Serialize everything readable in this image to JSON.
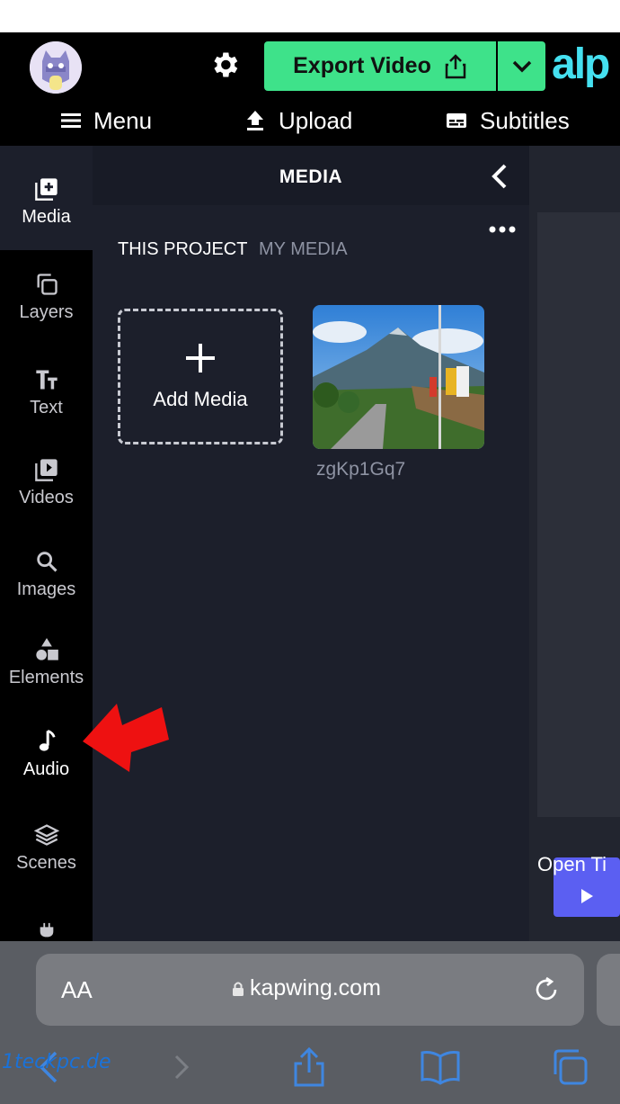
{
  "header": {
    "export_label": "Export Video",
    "brand": "alp",
    "nav": {
      "menu": "Menu",
      "upload": "Upload",
      "subtitles": "Subtitles"
    }
  },
  "sidebar": {
    "items": [
      {
        "label": "Media",
        "icon": "media-plus-icon"
      },
      {
        "label": "Layers",
        "icon": "layers-icon"
      },
      {
        "label": "Text",
        "icon": "text-icon"
      },
      {
        "label": "Videos",
        "icon": "videos-icon"
      },
      {
        "label": "Images",
        "icon": "search-icon"
      },
      {
        "label": "Elements",
        "icon": "shapes-icon"
      },
      {
        "label": "Audio",
        "icon": "music-note-icon"
      },
      {
        "label": "Scenes",
        "icon": "scenes-icon"
      }
    ]
  },
  "panel": {
    "title": "MEDIA",
    "tabs": [
      "THIS PROJECT",
      "MY MEDIA"
    ],
    "add_media_label": "Add Media",
    "media_items": [
      {
        "name": "zgKp1Gq7"
      }
    ]
  },
  "canvas": {
    "open_timeline": "Open Ti"
  },
  "browser": {
    "aa_label": "AA",
    "url": "kapwing.com"
  },
  "watermark": "1teckpc.de",
  "colors": {
    "accent_green": "#3ee28a",
    "brand_cyan": "#45e0f0",
    "panel_bg": "#1c1f2b",
    "play_blue": "#5b5ff2",
    "arrow_red": "#ee1111"
  }
}
